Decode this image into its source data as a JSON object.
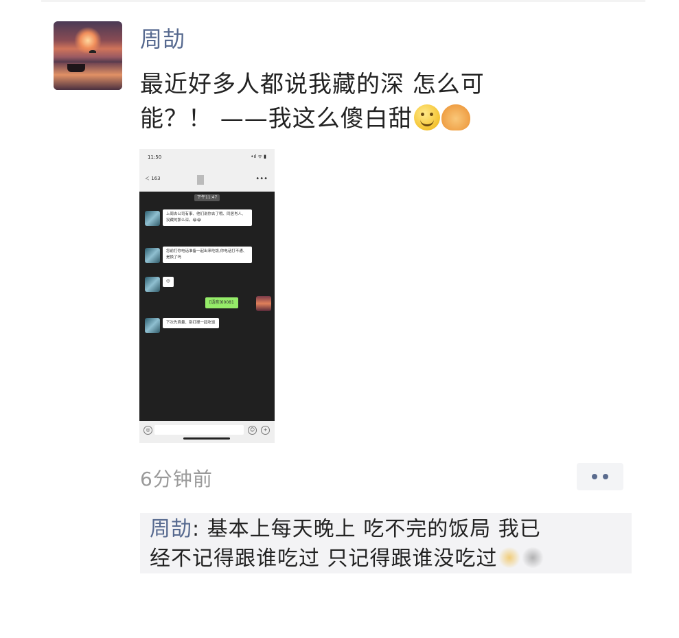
{
  "post": {
    "username": "周劼",
    "text_line1": "最近好多人都说我藏的深   怎么可",
    "text_line2": "能？！ ——我这么傻白甜",
    "emojis": [
      "smile-emoji",
      "handshake-emoji"
    ],
    "timestamp": "6分钟前"
  },
  "screenshot": {
    "status_time": "11:50",
    "status_icons": "•ıl ᯤ ▮",
    "back_label": "＜ 163",
    "more": "•••",
    "time_badge": "下午11:47",
    "bubble1": "上周去公司有事、他们说你去了哦、同居肖人、没藏的那么深。😂😂",
    "bubble2": "您前打你电话准备一起出来吃饭,你电话打不通、是换了吗",
    "bubble3": "😊",
    "bubble_me": "[语音]60081",
    "bubble4": "下次先商量、别打搅一起吃饭",
    "input_left_icon": "◎",
    "input_right_icon1": "☺",
    "input_right_icon2": "+"
  },
  "comments": [
    {
      "author": "周劼",
      "separator": ": ",
      "text_line1": "基本上每天晚上 吃不完的饭局    我已",
      "text_line2": "经不记得跟谁吃过  只记得跟谁没吃过"
    }
  ],
  "colors": {
    "name_blue": "#56698f",
    "timestamp_gray": "#9a9a9a",
    "comment_bg": "#f3f3f5"
  }
}
